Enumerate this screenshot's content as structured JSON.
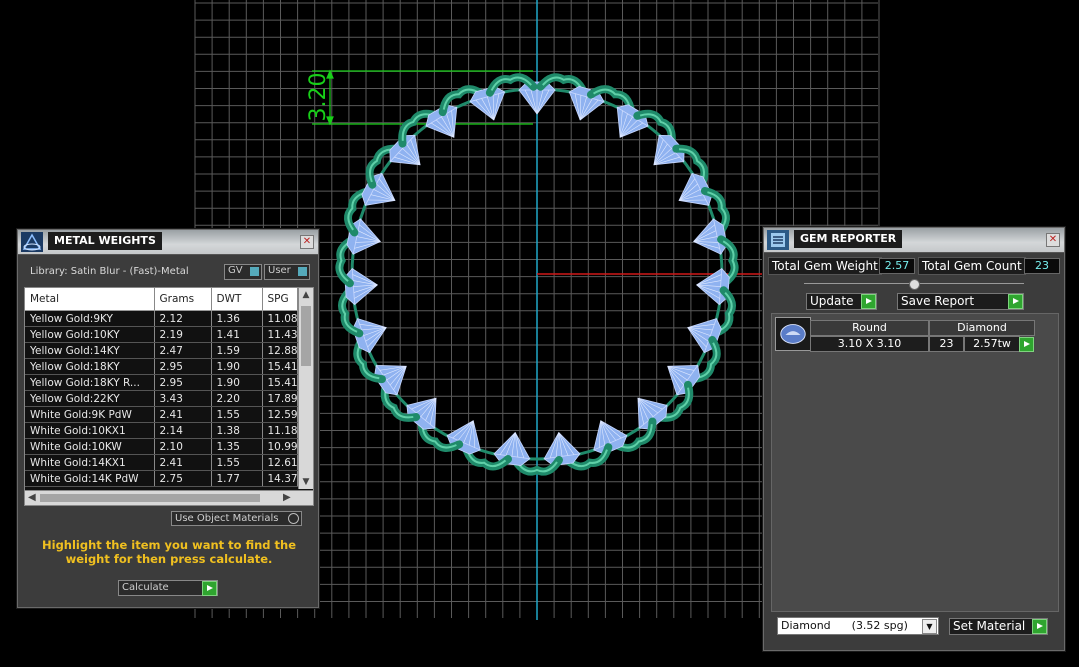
{
  "viewport": {
    "dimension_label": "3.20",
    "colors": {
      "grid": "#5a5a5a",
      "axis_y": "#20a8c8",
      "axis_x": "#d01818",
      "dimension": "#18d018",
      "metal": "#1f8a6a",
      "gem": "#8fb2f0"
    }
  },
  "metal_weights": {
    "title": "METAL WEIGHTS",
    "library": "Library: Satin Blur - (Fast)-Metal",
    "toggle_gv": "GV",
    "toggle_user": "User",
    "columns": [
      "Metal",
      "Grams",
      "DWT",
      "SPG"
    ],
    "rows": [
      [
        "Yellow Gold:9KY",
        "2.12",
        "1.36",
        "11.08"
      ],
      [
        "Yellow Gold:10KY",
        "2.19",
        "1.41",
        "11.43"
      ],
      [
        "Yellow Gold:14KY",
        "2.47",
        "1.59",
        "12.88"
      ],
      [
        "Yellow Gold:18KY",
        "2.95",
        "1.90",
        "15.41"
      ],
      [
        "Yellow Gold:18KY R...",
        "2.95",
        "1.90",
        "15.41"
      ],
      [
        "Yellow Gold:22KY",
        "3.43",
        "2.20",
        "17.89"
      ],
      [
        "White Gold:9K PdW",
        "2.41",
        "1.55",
        "12.59"
      ],
      [
        "White Gold:10KX1",
        "2.14",
        "1.38",
        "11.18"
      ],
      [
        "White Gold:10KW",
        "2.10",
        "1.35",
        "10.99"
      ],
      [
        "White Gold:14KX1",
        "2.41",
        "1.55",
        "12.61"
      ],
      [
        "White Gold:14K PdW",
        "2.75",
        "1.77",
        "14.37"
      ]
    ],
    "use_object_materials": "Use Object Materials",
    "hint": "Highlight the item you want to find the weight for then press calculate.",
    "calculate": "Calculate"
  },
  "gem_reporter": {
    "title": "GEM REPORTER",
    "total_weight_label": "Total Gem Weight",
    "total_weight_value": "2.57",
    "total_count_label": "Total Gem Count",
    "total_count_value": "23",
    "update": "Update",
    "save_report": "Save Report",
    "gem": {
      "shape": "Round",
      "material": "Diamond",
      "size": "3.10 X 3.10",
      "count": "23",
      "weight": "2.57tw"
    },
    "material_select": "Diamond      (3.52 spg)",
    "set_material": "Set Material"
  }
}
